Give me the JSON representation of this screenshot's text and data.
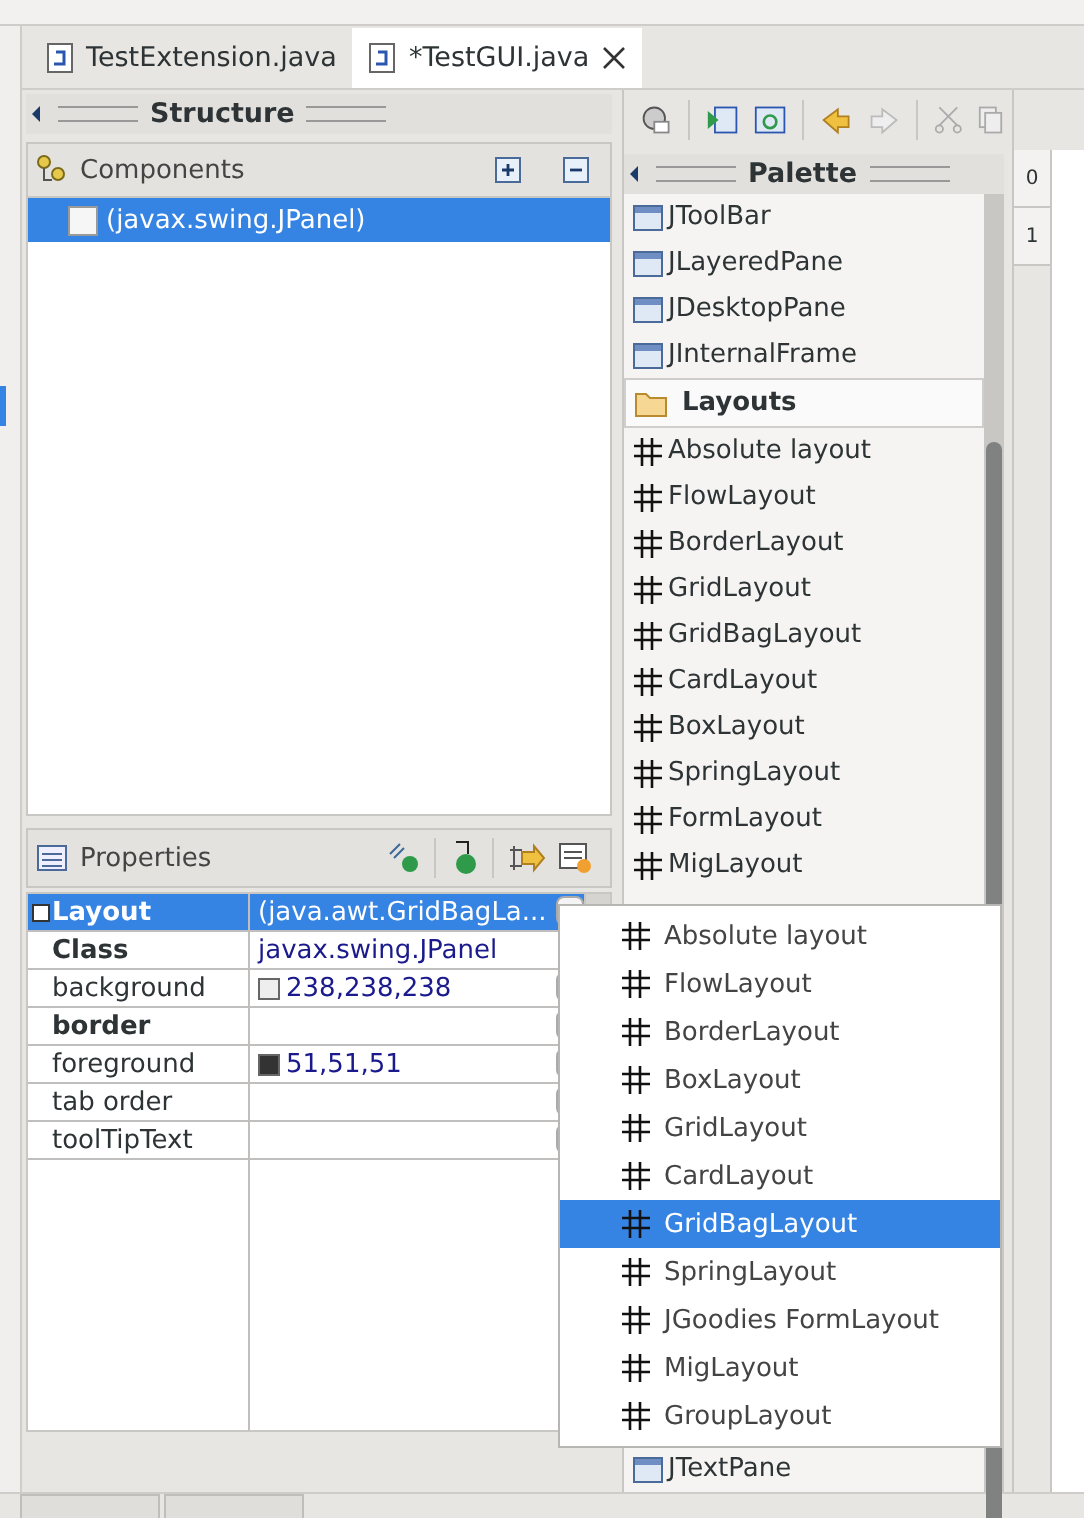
{
  "editor_tabs": [
    {
      "label": "TestExtension.java",
      "selected": false
    },
    {
      "label": "*TestGUI.java",
      "selected": true
    }
  ],
  "structure": {
    "title": "Structure",
    "components_title": "Components",
    "tree": [
      {
        "label": "(javax.swing.JPanel)",
        "selected": true
      }
    ]
  },
  "properties": {
    "title": "Properties",
    "rows": [
      {
        "name": "Layout",
        "value": "(java.awt.GridBagLa...",
        "bold": true,
        "expandable": true,
        "selected": true,
        "kind": "dropdown"
      },
      {
        "name": "Class",
        "value": "javax.swing.JPanel",
        "bold": true,
        "expandable": false,
        "selected": false,
        "kind": "plain"
      },
      {
        "name": "background",
        "value": "238,238,238",
        "color": "#eeeeee",
        "bold": false,
        "expandable": false,
        "selected": false,
        "kind": "color"
      },
      {
        "name": "border",
        "bold": true,
        "expandable": false,
        "selected": false,
        "kind": "button"
      },
      {
        "name": "foreground",
        "value": "51,51,51",
        "color": "#333333",
        "bold": false,
        "expandable": false,
        "selected": false,
        "kind": "color"
      },
      {
        "name": "tab order",
        "bold": false,
        "expandable": false,
        "selected": false,
        "kind": "button"
      },
      {
        "name": "toolTipText",
        "bold": false,
        "expandable": false,
        "selected": false,
        "kind": "button"
      }
    ]
  },
  "palette": {
    "title": "Palette",
    "items": [
      {
        "label": "JToolBar",
        "kind": "component"
      },
      {
        "label": "JLayeredPane",
        "kind": "component"
      },
      {
        "label": "JDesktopPane",
        "kind": "component"
      },
      {
        "label": "JInternalFrame",
        "kind": "component"
      },
      {
        "label": "Layouts",
        "kind": "category"
      },
      {
        "label": "Absolute layout",
        "kind": "layout"
      },
      {
        "label": "FlowLayout",
        "kind": "layout"
      },
      {
        "label": "BorderLayout",
        "kind": "layout"
      },
      {
        "label": "GridLayout",
        "kind": "layout"
      },
      {
        "label": "GridBagLayout",
        "kind": "layout"
      },
      {
        "label": "CardLayout",
        "kind": "layout"
      },
      {
        "label": "BoxLayout",
        "kind": "layout"
      },
      {
        "label": "SpringLayout",
        "kind": "layout"
      },
      {
        "label": "FormLayout",
        "kind": "layout"
      },
      {
        "label": "MigLayout",
        "kind": "layout"
      }
    ],
    "bottom_item": {
      "label": "JTextPane",
      "kind": "component"
    }
  },
  "ruler": [
    "0",
    "1"
  ],
  "layout_menu": [
    {
      "label": "Absolute layout",
      "selected": false
    },
    {
      "label": "FlowLayout",
      "selected": false
    },
    {
      "label": "BorderLayout",
      "selected": false
    },
    {
      "label": "BoxLayout",
      "selected": false
    },
    {
      "label": "GridLayout",
      "selected": false
    },
    {
      "label": "CardLayout",
      "selected": false
    },
    {
      "label": "GridBagLayout",
      "selected": true
    },
    {
      "label": "SpringLayout",
      "selected": false
    },
    {
      "label": "JGoodies FormLayout",
      "selected": false
    },
    {
      "label": "MigLayout",
      "selected": false
    },
    {
      "label": "GroupLayout",
      "selected": false
    }
  ]
}
